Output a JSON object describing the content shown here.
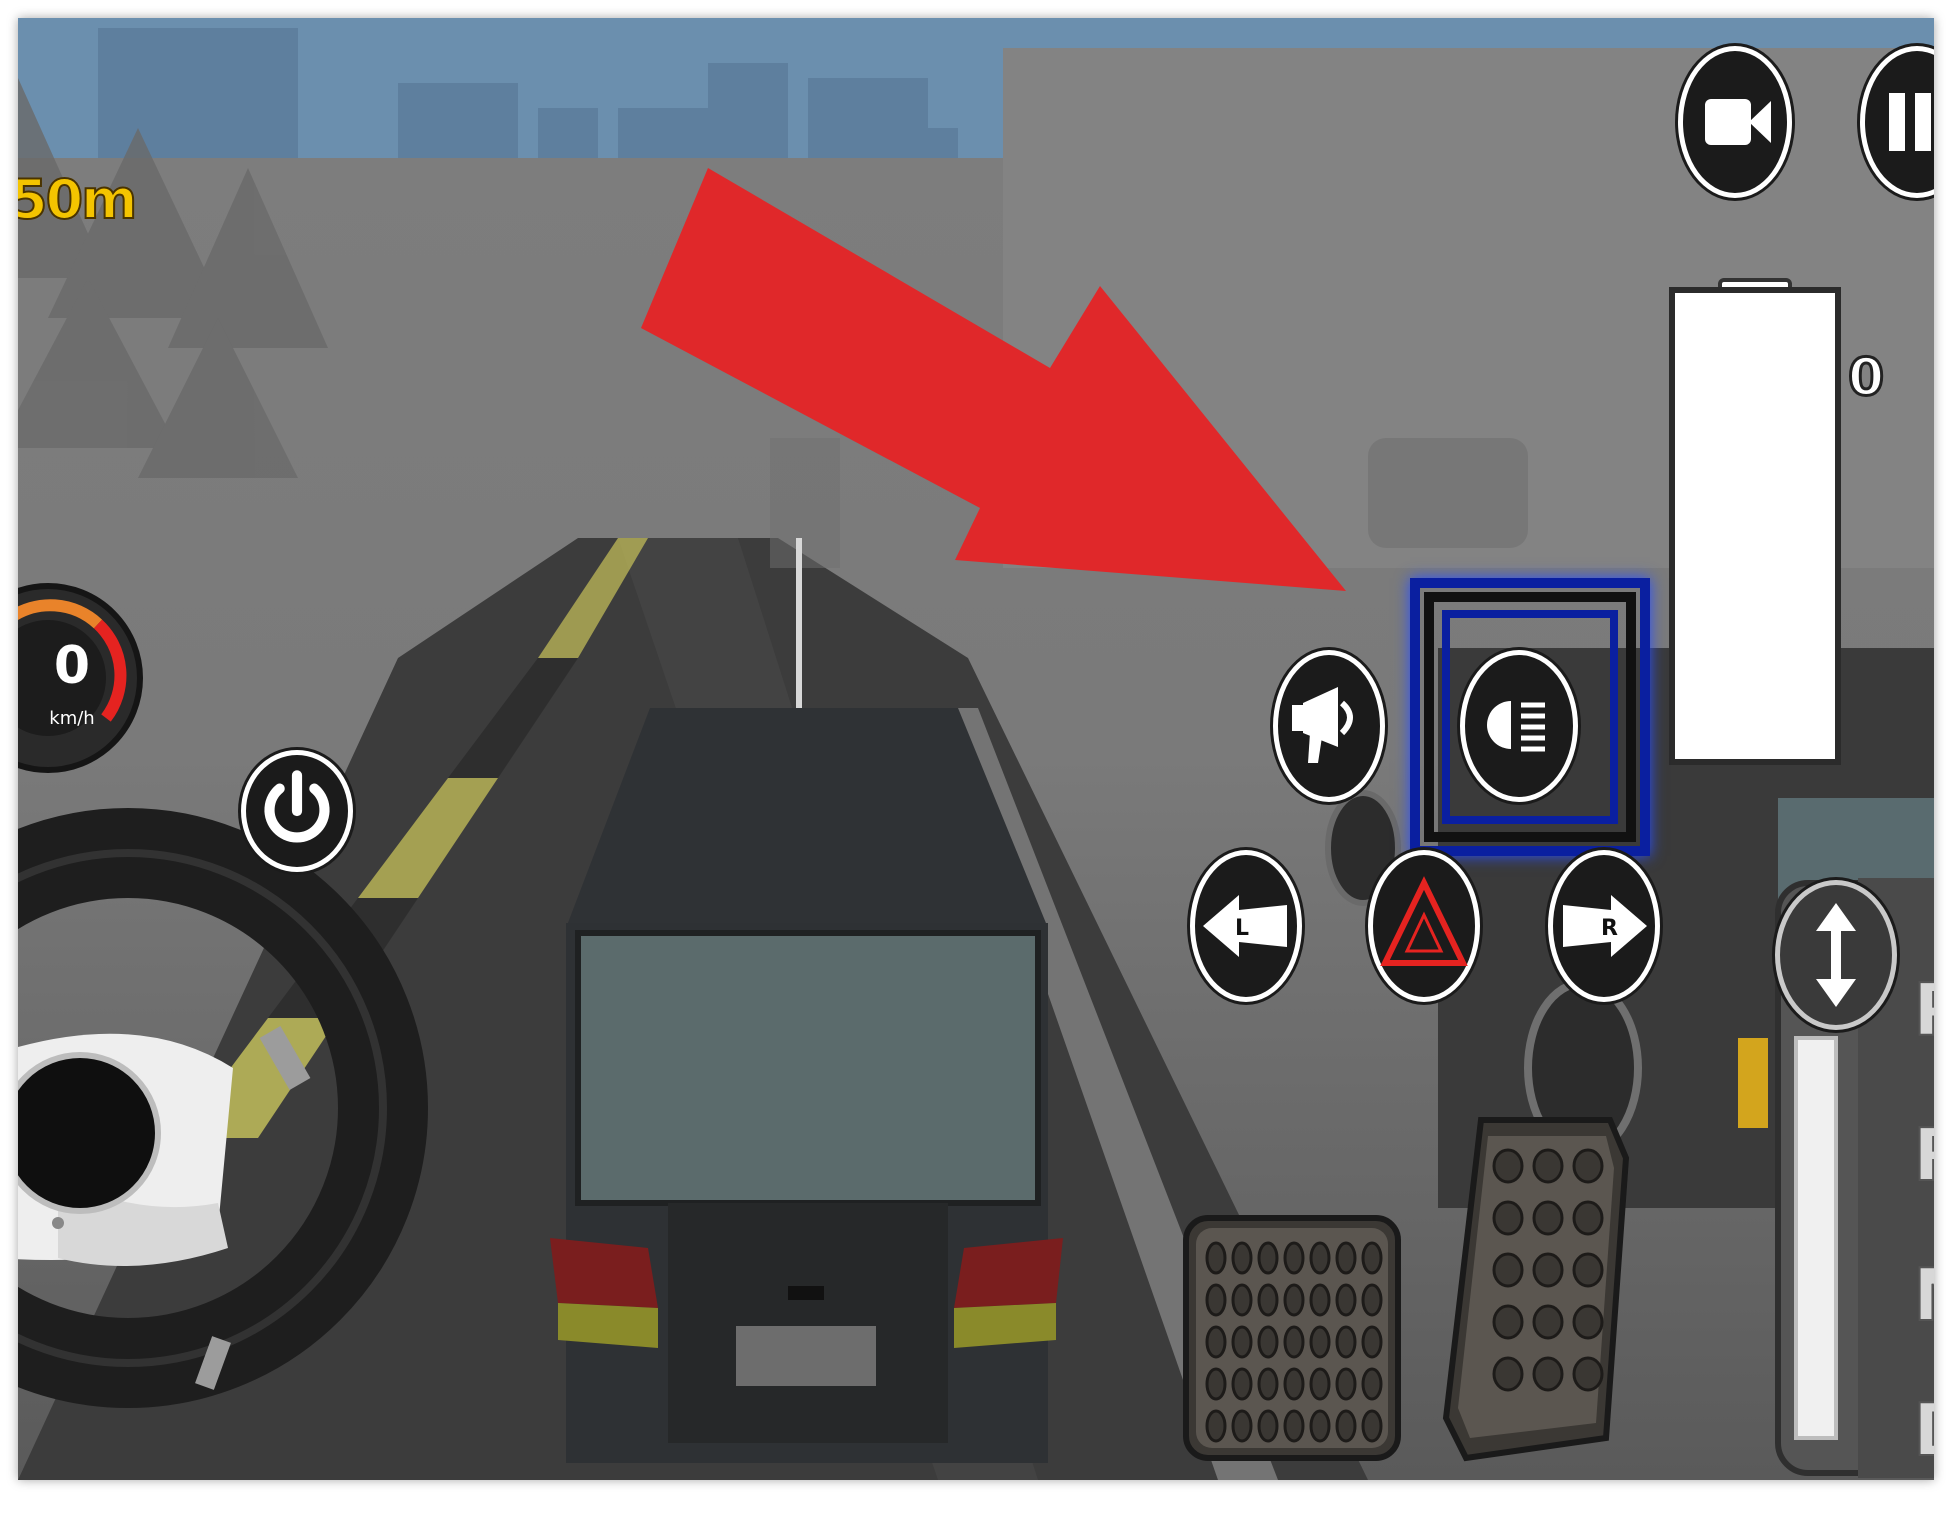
{
  "hud": {
    "distance": "50m",
    "speed_value": "0",
    "speed_unit": "km/h",
    "fuel_value": "0"
  },
  "gear_selector": {
    "gears": [
      "P",
      "R",
      "N",
      "D"
    ]
  },
  "buttons": {
    "camera": "camera-icon",
    "pause": "pause-icon",
    "power": "power-icon",
    "horn": "megaphone-icon",
    "headlight": "headlight-icon",
    "left_signal": "L",
    "hazard": "hazard-triangle-icon",
    "right_signal": "R"
  },
  "colors": {
    "arrow": "#e0282a",
    "highlight_box": "#0a1fa0",
    "distance_text": "#f4c400"
  }
}
